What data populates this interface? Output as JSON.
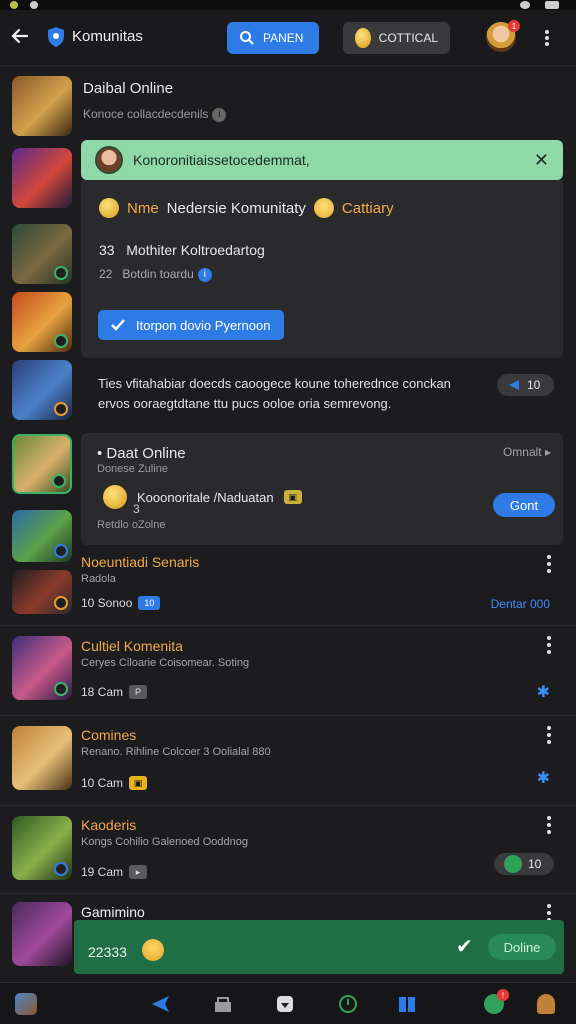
{
  "app": {
    "title": "Komunitas"
  },
  "header": {
    "primary_button": "PANEN",
    "secondary_button": "COTTICAL",
    "notification_count": "1"
  },
  "rows": {
    "first": {
      "title": "Daibal Online",
      "subtitle": "Konoce collacdecdenils"
    }
  },
  "toast": {
    "text": "Konoronitiaissetocedemmat,"
  },
  "popup": {
    "head_left": "Nme",
    "head_mid": "Nedersie Komunitaty",
    "head_right": "Cattiary",
    "line1_num": "33",
    "line1_text": "Mothiter Koltroedartog",
    "line2_num": "22",
    "line2_text": "Botdin toardu",
    "primary_label": "Itorpon dovio Pyernoon"
  },
  "description": {
    "text": "Ties vfitahabiar doecds caoogece koune toherednce conckan ervos ooraegtdtane ttu pucs ooloe oria semrevong.",
    "pill_value": "10"
  },
  "card2": {
    "title": "Daat Online",
    "link": "Omnalt",
    "subtitle": "Donese Zuline",
    "coin_text": "Kooonoritale /Naduatan",
    "coin_num": "3",
    "foot": "Retdlo oZolne",
    "cta": "Gont"
  },
  "list": [
    {
      "title": "Noeuntiadi Senaris",
      "sub": "Radola",
      "chip": "10 Sonoo",
      "chip_tag": "10",
      "right": "Dentar 000",
      "accent": "#3a8cf5"
    },
    {
      "title": "Cultiel Komenita",
      "sub": "Ceryes Ciloarie Coisomear. Soting",
      "chip": "18 Cam",
      "chip_tag": "P",
      "right": "",
      "accent": "#3a8cf5"
    },
    {
      "title": "Comines",
      "sub": "Renano. Rihline Colcoer 3 Oolialal 880",
      "chip": "10 Cam",
      "chip_tag": "",
      "right": "",
      "accent": "#3a8cf5"
    },
    {
      "title": "Kaoderis",
      "sub": "Kongs Cohilio Galenoed Ooddnog",
      "chip": "19 Cam",
      "chip_tag": "",
      "right": "10",
      "accent": "#2fa35a"
    },
    {
      "title": "Gamimino",
      "sub": "",
      "chip": "",
      "chip_tag": "",
      "right": "",
      "accent": ""
    }
  ],
  "banner": {
    "number": "22333",
    "button": "Doline"
  },
  "colors": {
    "accent_blue": "#2f7be6",
    "accent_orange": "#f2a94a",
    "toast_green": "#8fd9a8",
    "banner_green": "#1f6e46"
  }
}
